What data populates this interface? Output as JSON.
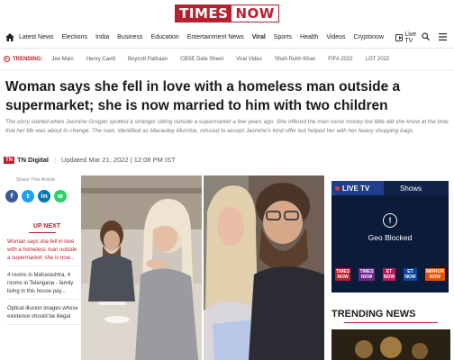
{
  "logo": {
    "part1": "TIMES",
    "part2": "NOW"
  },
  "nav": {
    "items": [
      "Latest News",
      "Elections",
      "India",
      "Business",
      "Education",
      "Entertainment News",
      "Viral",
      "Sports",
      "Health",
      "Videos",
      "Cryptonow"
    ],
    "bold_item": "Viral",
    "live_tv": "Live TV"
  },
  "trending": {
    "label": "TRENDING:",
    "items": [
      "Jee Main",
      "Henry Cavill",
      "Boycott Pathaan",
      "CBSE Date Sheet",
      "Viral Video",
      "Shah Rukh Khan",
      "FIFA 2022",
      "LOT 2022"
    ]
  },
  "article": {
    "headline": "Woman says she fell in love with a homeless man outside a supermarket; she is now married to him with two children",
    "summary": "The story started when Jasmine Grogan spotted a stranger sitting outside a supermarket a few years ago. She offered the man some money but little did she know at the time that her life was about to change. The man, identified as Macauley Murchie, refused to accept Jasmine's kind offer but helped her with her heavy shopping bags.",
    "author": "TN Digital",
    "tn_badge": "TN",
    "updated": "Updated Mar 21, 2022 | 12:08 PM IST",
    "share_label": "Share This Article"
  },
  "share_icons": [
    {
      "name": "facebook-icon",
      "glyph": "f",
      "color": "#3b5998"
    },
    {
      "name": "twitter-icon",
      "glyph": "t",
      "color": "#1da1f2"
    },
    {
      "name": "linkedin-icon",
      "glyph": "in",
      "color": "#0077b5"
    },
    {
      "name": "whatsapp-icon",
      "glyph": "w",
      "color": "#25d366"
    }
  ],
  "upnext": {
    "title": "UP NEXT",
    "items": [
      "Woman says she fell in love with a homeless man outside a supermarket; she is now...",
      "4 rooms in Maharashtra, 4 rooms in Telangana - family living in this house pay...",
      "Optical illusion images whose existence should be illegal"
    ]
  },
  "live": {
    "title": "LIVE TV",
    "shows": "Shows",
    "geo_blocked": "Geo Blocked",
    "channels": [
      {
        "line1": "TIMES",
        "line2": "NOW",
        "color": "#b7202e"
      },
      {
        "line1": "TIMES",
        "line2": "NOW",
        "color": "#6a2a8a"
      },
      {
        "line1": "ET",
        "line2": "NOW",
        "color": "#c2185b"
      },
      {
        "line1": "ET",
        "line2": "NOW",
        "color": "#0d47a1"
      },
      {
        "line1": "MIRROR",
        "line2": "NOW",
        "color": "#e65100"
      }
    ]
  },
  "trending_news": {
    "title": "TRENDING NEWS"
  }
}
